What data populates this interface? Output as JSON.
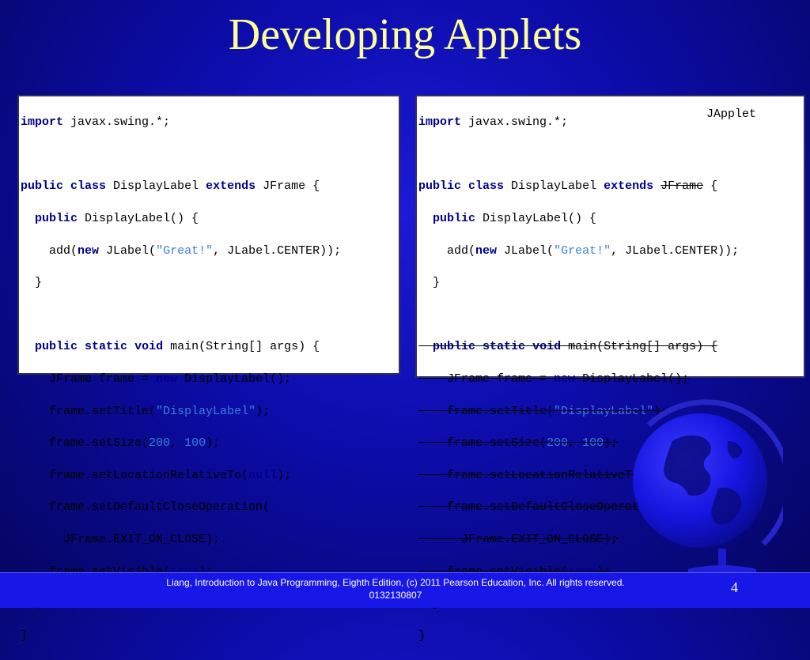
{
  "slide": {
    "title": "Developing Applets",
    "annotation": "JApplet",
    "footer": "Liang, Introduction to Java Programming, Eighth Edition, (c) 2011 Pearson Education, Inc. All rights reserved. 0132130807",
    "page_number": "4"
  },
  "code": {
    "import_kw": "import",
    "import_rest": " javax.swing.*;",
    "public_kw": "public",
    "class_kw": "class",
    "class_name": " DisplayLabel ",
    "extends_kw": "extends",
    "superclass": "JFrame",
    "open_brace": " {",
    "ctor_rest": " DisplayLabel() {",
    "add_open": "add(",
    "new_kw": "new",
    "jlabel_open": " JLabel(",
    "great_str": "\"Great!\"",
    "center_rest": ", JLabel.CENTER));",
    "close_brace": "}",
    "static_kw": "static",
    "void_kw": "void",
    "main_rest": " main(String[] args) {",
    "frame_decl": "JFrame frame = ",
    "display_label_call": " DisplayLabel();",
    "set_title_open": "frame.setTitle(",
    "display_label_str": "\"DisplayLabel\"",
    "stmt_end": ");",
    "set_size_open": "frame.setSize(",
    "size_w": "200",
    "comma": ", ",
    "size_h": "100",
    "set_loc_open": "frame.setLocationRelativeTo(",
    "null_kw": "null",
    "set_close_op": "frame.setDefaultCloseOperation(",
    "exit_on_close": "JFrame.EXIT_ON_CLOSE);",
    "set_visible_open": "frame.setVisible(",
    "true_kw": "true"
  }
}
